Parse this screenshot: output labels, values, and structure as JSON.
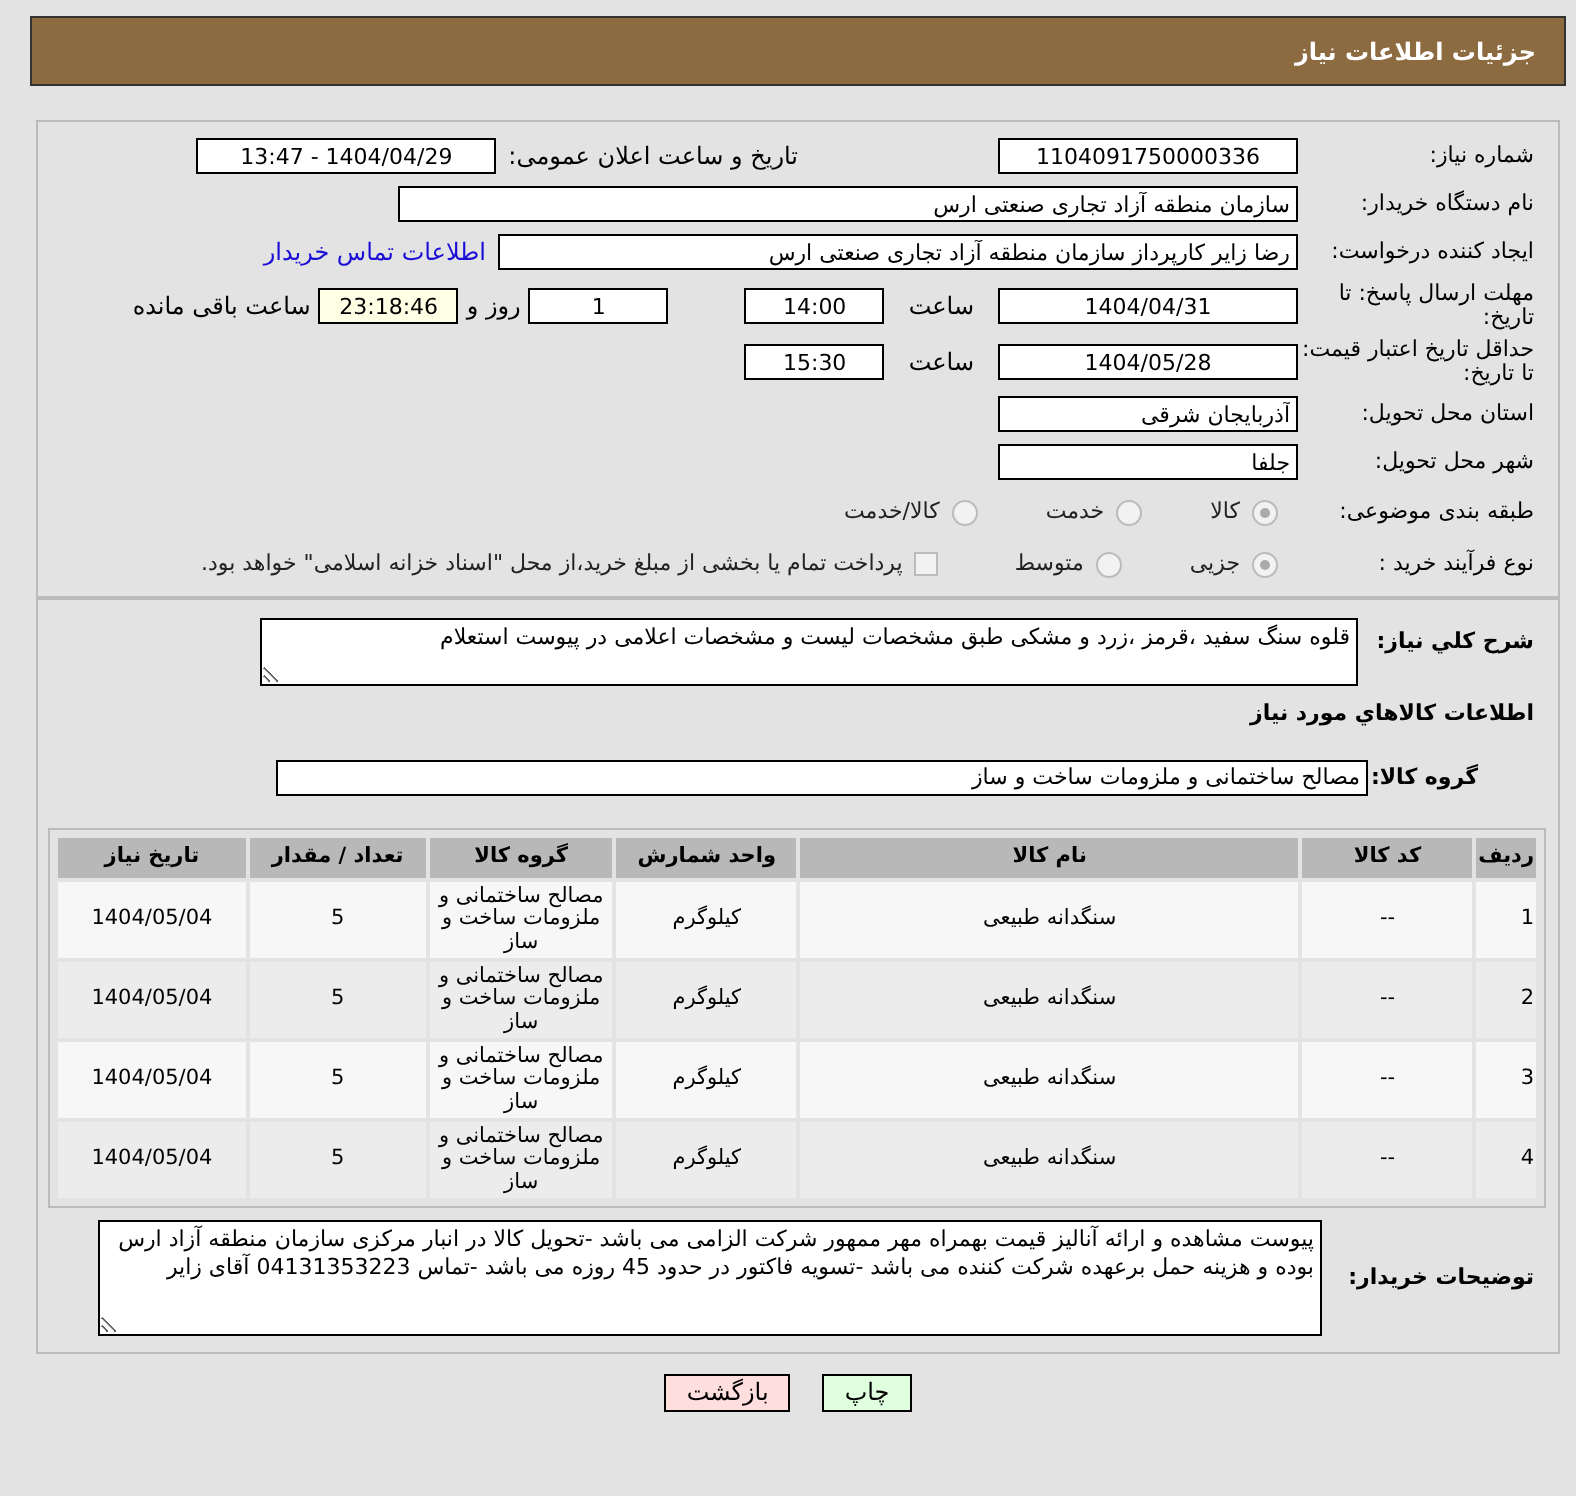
{
  "header": {
    "title": "جزئیات اطلاعات نیاز"
  },
  "need_number": {
    "label": "شماره نیاز:",
    "value": "1104091750000336"
  },
  "announce": {
    "label": "تاریخ و ساعت اعلان عمومی:",
    "value": "1404/04/29 - 13:47"
  },
  "buyer_org": {
    "label": "نام دستگاه خریدار:",
    "value": "سازمان منطقه آزاد تجاری صنعتی ارس"
  },
  "requester": {
    "label": "ایجاد کننده درخواست:",
    "value": "رضا زایر کارپرداز سازمان منطقه آزاد تجاری صنعتی ارس",
    "link": "اطلاعات تماس خریدار"
  },
  "deadline": {
    "label": "مهلت ارسال پاسخ: تا تاریخ:",
    "date": "1404/04/31",
    "time_label": "ساعت",
    "time": "14:00",
    "days": "1",
    "days_label": "روز و",
    "remaining": "23:18:46",
    "remaining_label": "ساعت باقی مانده"
  },
  "validity": {
    "label": "حداقل تاریخ اعتبار قیمت: تا تاریخ:",
    "date": "1404/05/28",
    "time_label": "ساعت",
    "time": "15:30"
  },
  "province": {
    "label": "استان محل تحویل:",
    "value": "آذربایجان شرقی"
  },
  "city": {
    "label": "شهر محل تحویل:",
    "value": "جلفا"
  },
  "category": {
    "label": "طبقه بندی موضوعی:",
    "options": [
      {
        "label": "کالا",
        "selected": true
      },
      {
        "label": "خدمت",
        "selected": false
      },
      {
        "label": "کالا/خدمت",
        "selected": false
      }
    ]
  },
  "purchase_type": {
    "label": "نوع فرآیند خرید :",
    "options": [
      {
        "label": "جزیی",
        "selected": true
      },
      {
        "label": "متوسط",
        "selected": false
      }
    ],
    "payment_note": {
      "label": "پرداخت تمام یا بخشی از مبلغ خرید،از محل \"اسناد خزانه اسلامی\" خواهد بود.",
      "checked": false
    }
  },
  "description": {
    "label": "شرح کلي نياز:",
    "value": "قلوه سنگ سفید ،قرمز ،زرد و مشکی طبق مشخصات لیست و مشخصات اعلامی در پیوست استعلام"
  },
  "goods_title": "اطلاعات کالاهاي مورد نياز",
  "goods_group": {
    "label": "گروه کالا:",
    "value": "مصالح ساختمانی و ملزومات ساخت و ساز"
  },
  "table": {
    "columns": [
      "ردیف",
      "کد کالا",
      "نام کالا",
      "واحد شمارش",
      "گروه کالا",
      "تعداد / مقدار",
      "تاریخ نیاز"
    ],
    "rows": [
      [
        "1",
        "--",
        "سنگدانه طبیعی",
        "کیلوگرم",
        "مصالح ساختمانی و ملزومات ساخت و ساز",
        "5",
        "1404/05/04"
      ],
      [
        "2",
        "--",
        "سنگدانه طبیعی",
        "کیلوگرم",
        "مصالح ساختمانی و ملزومات ساخت و ساز",
        "5",
        "1404/05/04"
      ],
      [
        "3",
        "--",
        "سنگدانه طبیعی",
        "کیلوگرم",
        "مصالح ساختمانی و ملزومات ساخت و ساز",
        "5",
        "1404/05/04"
      ],
      [
        "4",
        "--",
        "سنگدانه طبیعی",
        "کیلوگرم",
        "مصالح ساختمانی و ملزومات ساخت و ساز",
        "5",
        "1404/05/04"
      ]
    ]
  },
  "buyer_notes": {
    "label": "توضیحات خریدار:",
    "value": "پیوست مشاهده و ارائه آنالیز قیمت بهمراه مهر ممهور شرکت الزامی می باشد -تحویل کالا در انبار مرکزی سازمان منطقه آزاد ارس بوده و هزینه حمل برعهده شرکت کننده می باشد -تسویه فاکتور در حدود 45 روزه می باشد -تماس 04131353223 آقای زایر"
  },
  "buttons": [
    {
      "label": "چاپ",
      "kind": "print"
    },
    {
      "label": "بازگشت",
      "kind": "back"
    }
  ]
}
